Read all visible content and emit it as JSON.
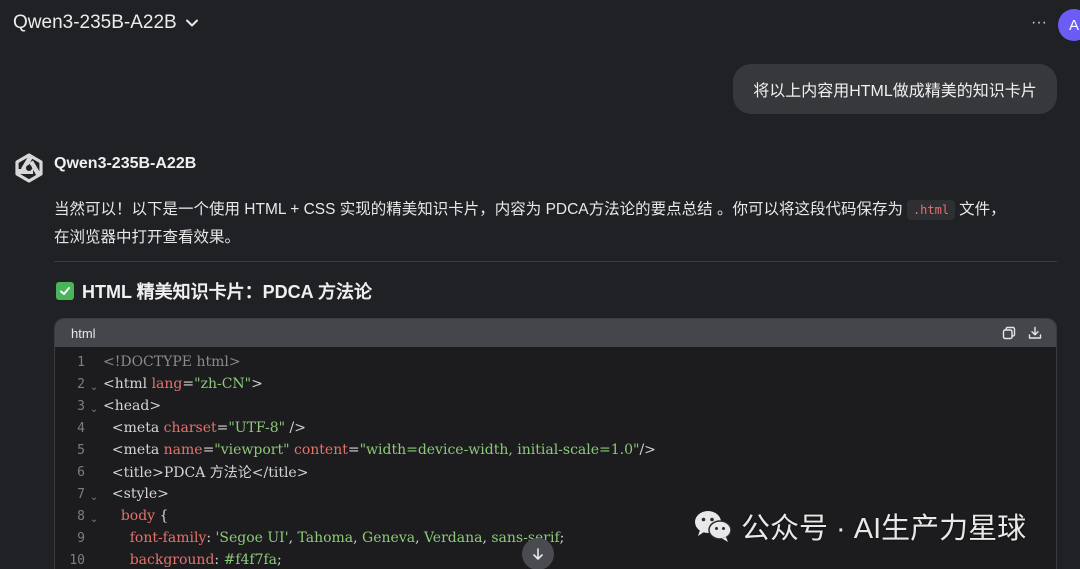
{
  "header": {
    "model_name": "Qwen3-235B-A22B",
    "more_label": "···",
    "avatar_letter": "A"
  },
  "user_message": "将以上内容用HTML做成精美的知识卡片",
  "assistant": {
    "name": "Qwen3-235B-A22B",
    "intro_part1": "当然可以！以下是一个使用 HTML + CSS 实现的精美知识卡片，内容为 PDCA方法论的要点总结 。你可以将这段代码保存为",
    "inline_code": ".html",
    "intro_part2": "文件，",
    "intro_line2": "在浏览器中打开查看效果。",
    "heading": "HTML 精美知识卡片：PDCA 方法论"
  },
  "code_block": {
    "language": "html",
    "lines": [
      {
        "n": "1",
        "fold": false,
        "indent": "",
        "tokens": [
          {
            "t": "<!DOCTYPE html>",
            "c": "#8a8a8a"
          }
        ]
      },
      {
        "n": "2",
        "fold": true,
        "indent": "",
        "tokens": [
          {
            "t": "<html ",
            "c": "#d4d4d4"
          },
          {
            "t": "lang",
            "c": "#e3736b"
          },
          {
            "t": "=",
            "c": "#d4d4d4"
          },
          {
            "t": "\"zh-CN\"",
            "c": "#8cc97a"
          },
          {
            "t": ">",
            "c": "#d4d4d4"
          }
        ]
      },
      {
        "n": "3",
        "fold": true,
        "indent": "",
        "tokens": [
          {
            "t": "<head>",
            "c": "#d4d4d4"
          }
        ]
      },
      {
        "n": "4",
        "fold": false,
        "indent": "  ",
        "tokens": [
          {
            "t": "<meta ",
            "c": "#d4d4d4"
          },
          {
            "t": "charset",
            "c": "#e3736b"
          },
          {
            "t": "=",
            "c": "#d4d4d4"
          },
          {
            "t": "\"UTF-8\"",
            "c": "#8cc97a"
          },
          {
            "t": " />",
            "c": "#d4d4d4"
          }
        ]
      },
      {
        "n": "5",
        "fold": false,
        "indent": "  ",
        "tokens": [
          {
            "t": "<meta ",
            "c": "#d4d4d4"
          },
          {
            "t": "name",
            "c": "#e3736b"
          },
          {
            "t": "=",
            "c": "#d4d4d4"
          },
          {
            "t": "\"viewport\"",
            "c": "#8cc97a"
          },
          {
            "t": " ",
            "c": "#d4d4d4"
          },
          {
            "t": "content",
            "c": "#e3736b"
          },
          {
            "t": "=",
            "c": "#d4d4d4"
          },
          {
            "t": "\"width=device-width, initial-scale=1.0\"",
            "c": "#8cc97a"
          },
          {
            "t": "/>",
            "c": "#d4d4d4"
          }
        ]
      },
      {
        "n": "6",
        "fold": false,
        "indent": "  ",
        "tokens": [
          {
            "t": "<title>",
            "c": "#d4d4d4"
          },
          {
            "t": "PDCA 方法论",
            "c": "#d4d4d4"
          },
          {
            "t": "</title>",
            "c": "#d4d4d4"
          }
        ]
      },
      {
        "n": "7",
        "fold": true,
        "indent": "  ",
        "tokens": [
          {
            "t": "<style>",
            "c": "#d4d4d4"
          }
        ]
      },
      {
        "n": "8",
        "fold": true,
        "indent": "    ",
        "tokens": [
          {
            "t": "body",
            "c": "#e3736b"
          },
          {
            "t": " {",
            "c": "#d4d4d4"
          }
        ]
      },
      {
        "n": "9",
        "fold": false,
        "indent": "      ",
        "tokens": [
          {
            "t": "font-family",
            "c": "#e3736b"
          },
          {
            "t": ": ",
            "c": "#d4d4d4"
          },
          {
            "t": "'Segoe UI'",
            "c": "#8cc97a"
          },
          {
            "t": ", ",
            "c": "#d4d4d4"
          },
          {
            "t": "Tahoma",
            "c": "#8cc97a"
          },
          {
            "t": ", ",
            "c": "#d4d4d4"
          },
          {
            "t": "Geneva",
            "c": "#8cc97a"
          },
          {
            "t": ", ",
            "c": "#d4d4d4"
          },
          {
            "t": "Verdana",
            "c": "#8cc97a"
          },
          {
            "t": ", ",
            "c": "#d4d4d4"
          },
          {
            "t": "sans-serif",
            "c": "#8cc97a"
          },
          {
            "t": ";",
            "c": "#d4d4d4"
          }
        ]
      },
      {
        "n": "10",
        "fold": false,
        "indent": "      ",
        "tokens": [
          {
            "t": "background",
            "c": "#e3736b"
          },
          {
            "t": ": ",
            "c": "#d4d4d4"
          },
          {
            "t": "#f4f7fa",
            "c": "#8cc97a"
          },
          {
            "t": ";",
            "c": "#d4d4d4"
          }
        ]
      }
    ]
  },
  "watermark": {
    "text": "公众号 · AI生产力星球"
  },
  "colors": {
    "background": "#202124",
    "bubble": "#37383b",
    "avatar": "#6b5cf6",
    "check": "#4bb35a",
    "inline_code": "#ef6b6b"
  },
  "icons": [
    "chevron-down-icon",
    "more-icon",
    "qwen-logo-icon",
    "check-icon",
    "copy-icon",
    "download-icon",
    "wechat-icon",
    "arrow-down-icon"
  ]
}
